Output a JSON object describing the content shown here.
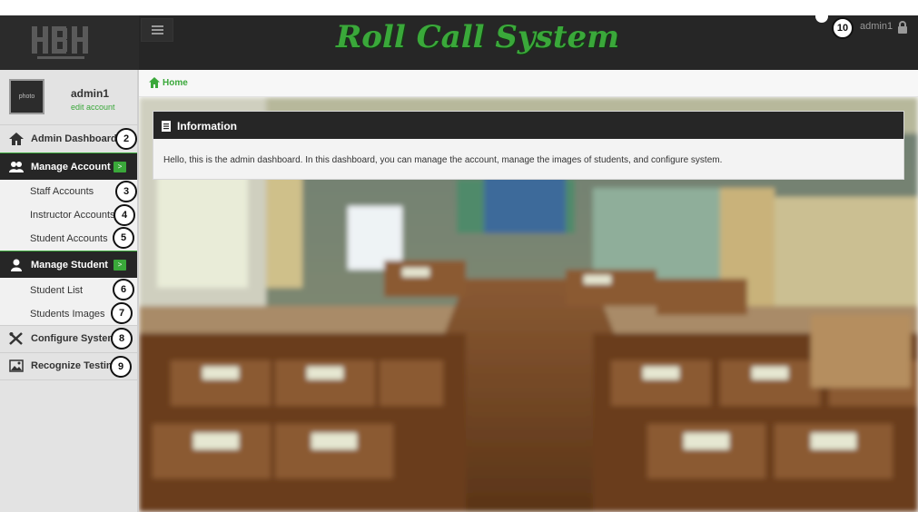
{
  "header": {
    "brand_title": "Roll Call System",
    "logo_text": "HBH",
    "notification_count": "10",
    "username": "admin1"
  },
  "profile": {
    "photo_label": "photo",
    "name": "admin1",
    "edit_link": "edit account"
  },
  "sidebar": {
    "items": [
      {
        "label": "Admin Dashboard",
        "icon": "home-icon",
        "badge": "2"
      },
      {
        "label": "Manage Account",
        "icon": "users-icon",
        "toggle": ">"
      },
      {
        "label": "Staff Accounts",
        "badge": "3"
      },
      {
        "label": "Instructor Accounts",
        "badge": "4"
      },
      {
        "label": "Student Accounts",
        "badge": "5"
      },
      {
        "label": "Manage Student",
        "icon": "user-icon",
        "toggle": ">"
      },
      {
        "label": "Student List",
        "badge": "6"
      },
      {
        "label": "Students Images",
        "badge": "7"
      },
      {
        "label": "Configure System",
        "icon": "tools-icon",
        "badge": "8"
      },
      {
        "label": "Recognize Testing",
        "icon": "image-icon",
        "badge": "9"
      }
    ]
  },
  "breadcrumb": {
    "home": "Home"
  },
  "panel": {
    "title": "Information",
    "body": "Hello, this is the admin dashboard. In this dashboard, you can manage the account, manage the images of students, and configure system."
  },
  "colors": {
    "accent": "#3aa83a",
    "dark": "#262626",
    "sidebar": "#e3e3e3"
  }
}
